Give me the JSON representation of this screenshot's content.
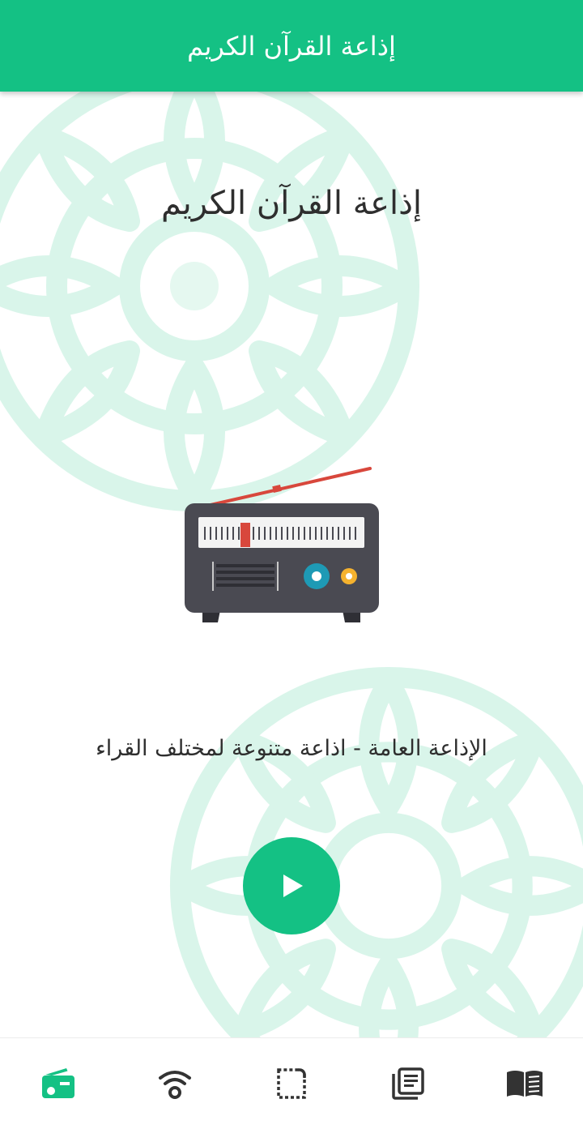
{
  "appbar": {
    "title": "إذاعة القرآن الكريم"
  },
  "station": {
    "title": "إذاعة القرآن الكريم",
    "description": "الإذاعة العامة - اذاعة متنوعة لمختلف القراء",
    "illustration": "vintage-radio"
  },
  "player": {
    "play_icon": "play-icon"
  },
  "bottom_nav": {
    "items": [
      {
        "icon": "radio-icon",
        "active": true
      },
      {
        "icon": "wifi-icon",
        "active": false
      },
      {
        "icon": "crop-icon",
        "active": false
      },
      {
        "icon": "articles-icon",
        "active": false
      },
      {
        "icon": "book-icon",
        "active": false
      }
    ]
  },
  "colors": {
    "accent": "#14c184",
    "ornament": "#d9f5ea",
    "icon_inactive": "#333333",
    "radio_body": "#4a4a52",
    "radio_antenna": "#d8473c",
    "radio_knob_teal": "#1e9ab5",
    "radio_knob_yellow": "#f5b22e"
  }
}
